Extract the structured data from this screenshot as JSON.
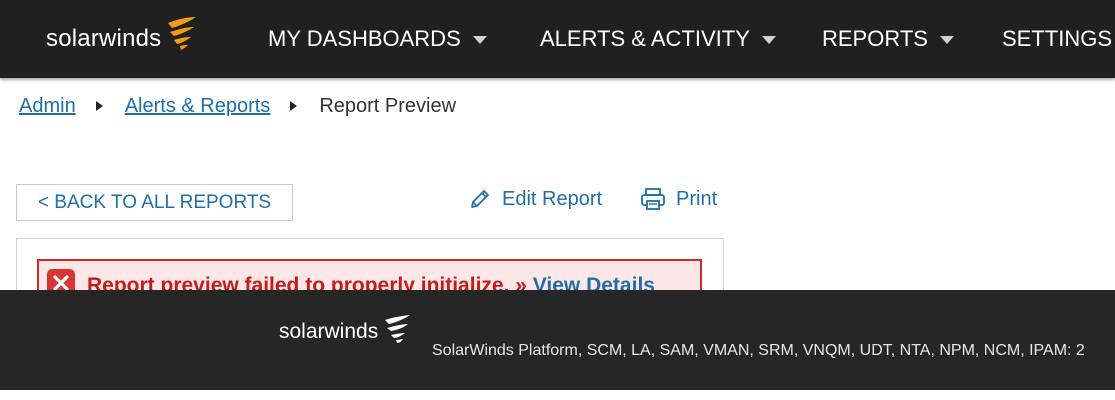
{
  "brand": {
    "name": "solarwinds",
    "accent_color": "#f39c12"
  },
  "nav": {
    "items": [
      {
        "label": "MY DASHBOARDS",
        "has_dropdown": true
      },
      {
        "label": "ALERTS & ACTIVITY",
        "has_dropdown": true
      },
      {
        "label": "REPORTS",
        "has_dropdown": true
      },
      {
        "label": "SETTINGS",
        "has_dropdown": false
      }
    ]
  },
  "breadcrumb": {
    "items": [
      "Admin",
      "Alerts & Reports"
    ],
    "current": "Report Preview"
  },
  "actions": {
    "back_label": "< BACK TO ALL REPORTS",
    "edit_label": "Edit Report",
    "edit_icon": "pencil-icon",
    "print_label": "Print",
    "print_icon": "printer-icon"
  },
  "error": {
    "icon": "error-x-icon",
    "message": "Report preview failed to properly initialize. » ",
    "link_label": "View Details",
    "color": "#c41b1b"
  },
  "footer": {
    "brand": "solarwinds",
    "products": "SolarWinds Platform, SCM, LA, SAM, VMAN, SRM, VNQM, UDT, NTA, NPM, NCM, IPAM: 2"
  }
}
